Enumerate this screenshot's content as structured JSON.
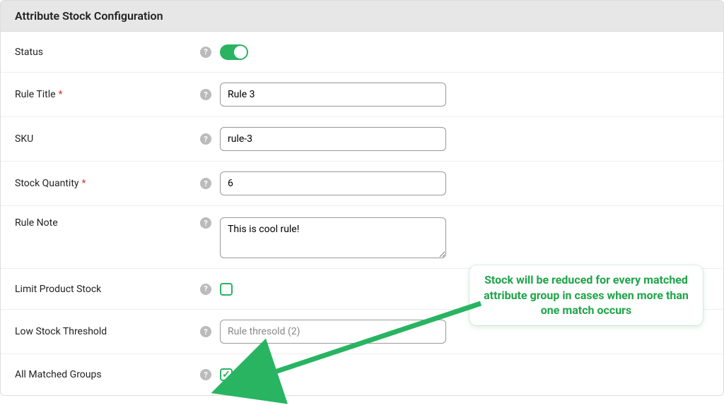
{
  "header": {
    "title": "Attribute Stock Configuration"
  },
  "fields": {
    "status": {
      "label": "Status",
      "required": false,
      "on": true
    },
    "rule_title": {
      "label": "Rule Title",
      "required": true,
      "value": "Rule 3"
    },
    "sku": {
      "label": "SKU",
      "required": false,
      "value": "rule-3"
    },
    "stock_qty": {
      "label": "Stock Quantity",
      "required": true,
      "value": "6"
    },
    "rule_note": {
      "label": "Rule Note",
      "required": false,
      "value": "This is cool rule!"
    },
    "limit_stock": {
      "label": "Limit Product Stock",
      "required": false,
      "checked": false
    },
    "low_thresh": {
      "label": "Low Stock Threshold",
      "required": false,
      "placeholder": "Rule thresold (2)",
      "value": ""
    },
    "all_matched": {
      "label": "All Matched Groups",
      "required": false,
      "checked": true
    }
  },
  "callout": {
    "text": "Stock will be reduced for every matched attribute group in cases when more than one match occurs"
  },
  "colors": {
    "accent": "#28b461"
  }
}
